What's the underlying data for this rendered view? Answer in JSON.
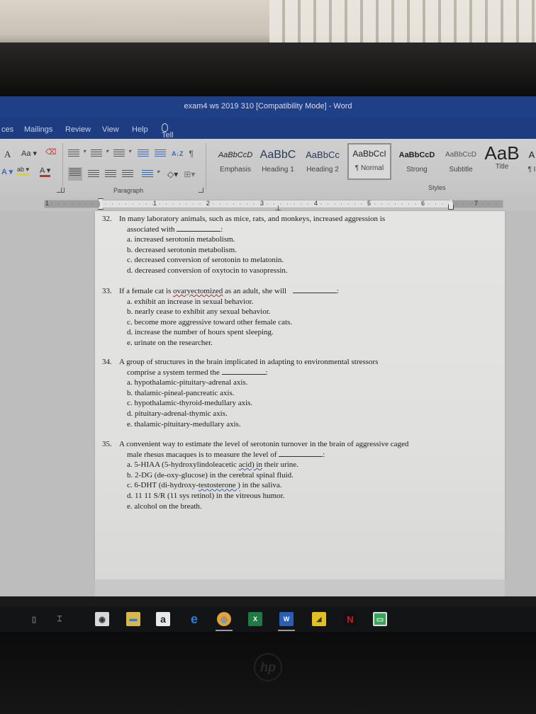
{
  "window": {
    "title": "exam4 ws 2019 310 [Compatibility Mode]  -  Word"
  },
  "menu": {
    "items": [
      "ces",
      "Mailings",
      "Review",
      "View",
      "Help"
    ],
    "tell_me": "Tell me what you want to do"
  },
  "ribbon": {
    "font_group": {
      "grow_font": "A",
      "change_case": "Aa",
      "text_effects": "A",
      "highlight": "ab",
      "font_color": "A"
    },
    "paragraph_group": {
      "label": "Paragraph",
      "sort": "A↓Z",
      "show_marks": "¶"
    },
    "styles_group": {
      "label": "Styles",
      "tiles": [
        {
          "sample": "AaBbCcD",
          "name": "Emphasis",
          "selected": false
        },
        {
          "sample": "AaBbC",
          "name": "Heading 1",
          "selected": false
        },
        {
          "sample": "AaBbCc",
          "name": "Heading 2",
          "selected": false
        },
        {
          "sample": "AaBbCcI",
          "name": "¶ Normal",
          "selected": true
        },
        {
          "sample": "AaBbCcD",
          "name": "Strong",
          "selected": false
        },
        {
          "sample": "AaBbCcD",
          "name": "Subtitle",
          "selected": false
        },
        {
          "sample": "AaB",
          "name": "Title",
          "selected": false
        },
        {
          "sample": "A",
          "name": "¶ I",
          "selected": false
        }
      ]
    }
  },
  "ruler": {
    "numbers": [
      "1",
      "1",
      "2",
      "3",
      "4",
      "5",
      "6",
      "7"
    ]
  },
  "document": {
    "questions": [
      {
        "number": "32.",
        "stem_line1": "In many laboratory animals, such as mice, rats, and monkeys, increased aggression is",
        "stem_line2": "associated with",
        "stem_end": ":",
        "options": [
          "a.  increased serotonin metabolism.",
          "b.  decreased serotonin metabolism.",
          "c.  decreased conversion of serotonin to melatonin.",
          "d.  decreased conversion of oxytocin to vasopressin."
        ]
      },
      {
        "number": "33.",
        "stem_pre": "If a female cat is ",
        "stem_flagged": "ovaryectomized",
        "stem_post": " as an adult, she will",
        "stem_end": ":",
        "options": [
          "a.  exhibit an increase in sexual behavior.",
          "b.  nearly cease to exhibit any sexual behavior.",
          "c.  become more aggressive toward other female cats.",
          "d.  increase the number of hours spent sleeping.",
          "e.  urinate on the researcher."
        ]
      },
      {
        "number": "34.",
        "stem_line1": "A group of structures in the brain implicated in adapting to environmental stressors",
        "stem_line2": "comprise a system termed the",
        "stem_end": ":",
        "options": [
          "a.  hypothalamic-pituitary-adrenal axis.",
          "b.  thalamic-pineal-pancreatic axis.",
          "c.  hypothalamic-thyroid-medullary axis.",
          "d.  pituitary-adrenal-thymic axis.",
          "e.  thalamic-pituitary-medullary axis."
        ]
      },
      {
        "number": "35.",
        "stem_line1": "A convenient way to estimate the level of serotonin turnover in the brain of aggressive caged",
        "stem_line2": "male rhesus macaques is to measure the level of",
        "stem_end": ":",
        "options": {
          "a_pre": "a.  5-HIAA (5-hydroxylindoleacetic ",
          "a_flagged": "acid) in",
          "a_post": " their urine.",
          "b": "b.  2-DG (de-oxy-glucose) in the cerebral spinal fluid.",
          "c_pre": "c.  6-DHT (di-hydroxy-",
          "c_flagged": "testosterone )",
          "c_post": " in the saliva.",
          "d": "d.  11 11 S/R (11 sys retinol) in the vitreous humor.",
          "e": "e.  alcohol on the breath."
        }
      }
    ]
  },
  "taskbar": {
    "apps": [
      {
        "name": "microphone",
        "glyph": "▯"
      },
      {
        "name": "task-view",
        "glyph": "⌶"
      },
      {
        "name": "camera",
        "glyph": "◉"
      },
      {
        "name": "file-explorer",
        "glyph": "▬"
      },
      {
        "name": "amazon",
        "glyph": "a"
      },
      {
        "name": "edge",
        "glyph": "e"
      },
      {
        "name": "chrome",
        "glyph": "◎"
      },
      {
        "name": "excel",
        "glyph": "X"
      },
      {
        "name": "word",
        "glyph": "W"
      },
      {
        "name": "sticky-notes",
        "glyph": "◢"
      },
      {
        "name": "netflix",
        "glyph": "N"
      },
      {
        "name": "green-app",
        "glyph": "▭"
      }
    ]
  },
  "colors": {
    "title_bar": "#1f3f86",
    "ribbon": "#c9c9c9",
    "page": "#e2e2e0",
    "taskbar": "#121416"
  }
}
